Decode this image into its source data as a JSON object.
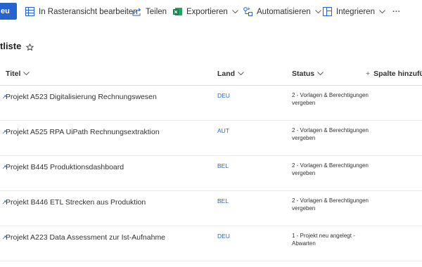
{
  "toolbar": {
    "new_label": "eu",
    "grid_edit_label": "In Rasteransicht bearbeiten",
    "share_label": "Teilen",
    "export_label": "Exportieren",
    "automate_label": "Automatisieren",
    "integrate_label": "Integrieren",
    "more_label": "···"
  },
  "list": {
    "title": "tliste"
  },
  "columns": {
    "title": "Titel",
    "land": "Land",
    "status": "Status",
    "add_column": "Spalte hinzufüg"
  },
  "rows": [
    {
      "title": "Projekt A523 Digitalisierung Rechnungswesen",
      "land": "DEU",
      "status": "2 - Vorlagen & Berechtigungen vergeben"
    },
    {
      "title": "Projekt A525 RPA UiPath Rechnungsextraktion",
      "land": "AUT",
      "status": "2 - Vorlagen & Berechtigungen vergeben"
    },
    {
      "title": "Projekt B445 Produktionsdashboard",
      "land": "BEL",
      "status": "2 - Vorlagen & Berechtigungen vergeben"
    },
    {
      "title": "Projekt B446 ETL Strecken aus Produktion",
      "land": "BEL",
      "status": "2 - Vorlagen & Berechtigungen vergeben"
    },
    {
      "title": "Projekt A223 Data Assessment zur Ist-Aufnahme",
      "land": "DEU",
      "status": "1 - Projekt neu angelegt - Abwarten"
    }
  ],
  "colors": {
    "accent": "#2564cf",
    "excel_green": "#107c41",
    "text": "#323130",
    "divider": "#e1dfdd"
  },
  "icons": [
    "grid-edit-icon",
    "share-icon",
    "excel-icon",
    "automate-icon",
    "integrate-icon",
    "chevron-down-icon",
    "star-icon",
    "new-item-icon"
  ]
}
